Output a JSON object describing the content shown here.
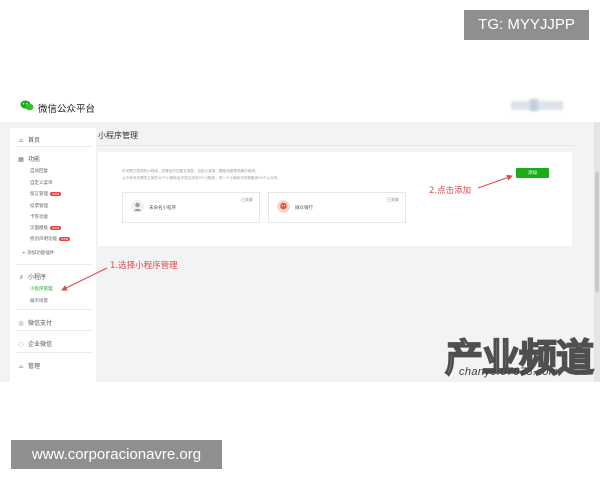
{
  "watermarks": {
    "top_badge": "TG: MYYJJPP",
    "bottom_badge": "www.corporacionavre.org",
    "channel_logo": "产业频道",
    "channel_site": "chanye.07073.com"
  },
  "header": {
    "app_title": "微信公众平台",
    "logo_icon": "wechat-logo-icon"
  },
  "sidebar": {
    "home": "首页",
    "features": "功能",
    "feature_items": [
      "自动回复",
      "自定义菜单",
      "留言管理",
      "投票管理",
      "卡券功能",
      "页面模板",
      "原创声明功能"
    ],
    "add_plugin": "+ 添加功能插件",
    "mini_program": "小程序",
    "mini_items": [
      "小程序管理",
      "展示场景"
    ],
    "wechat_pay": "微信支付",
    "enterprise": "企业微信",
    "manage": "管理"
  },
  "main": {
    "page_title": "小程序管理",
    "description_lines": [
      "可关联已发布的小程序，关联后可在图文消息、自定义菜单、模板消息等场景中使用。",
      "公众号可关联同主体的10个小程序及不同主体的3个小程序，同一个小程序可关联最多50个公众号。"
    ],
    "add_button": "添加",
    "cards": [
      {
        "name": "未命名小程序",
        "status": "已关联"
      },
      {
        "name": "微众银行",
        "status": "已关联"
      }
    ]
  },
  "annotations": {
    "step1": "1.选择小程序管理",
    "step2": "2.点击添加"
  },
  "colors": {
    "accent_green": "#1aad19",
    "annotation_red": "#e14b4b"
  }
}
